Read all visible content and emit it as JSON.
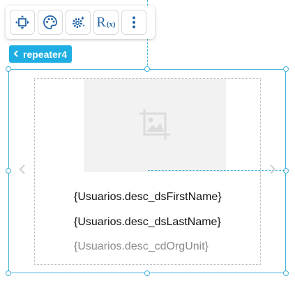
{
  "toolbar": {
    "buttons": [
      {
        "icon": "move-icon"
      },
      {
        "icon": "palette-icon"
      },
      {
        "icon": "settings-sparkle-icon"
      },
      {
        "icon": "rx-icon",
        "label": "R",
        "sub": "(x)"
      },
      {
        "icon": "more-vertical-icon"
      }
    ]
  },
  "component_tag": {
    "label": "repeater4"
  },
  "repeater": {
    "fields": [
      "{Usuarios.desc_dsFirstName}",
      "{Usuarios.desc_dsLastName}",
      "{Usuarios.desc_cdOrgUnit}"
    ]
  },
  "colors": {
    "accent": "#1eaee3",
    "selection": "#41b3d8",
    "icon": "#2565a8",
    "placeholder_bg": "#f2f2f2",
    "muted_text": "#8a8a8a"
  }
}
